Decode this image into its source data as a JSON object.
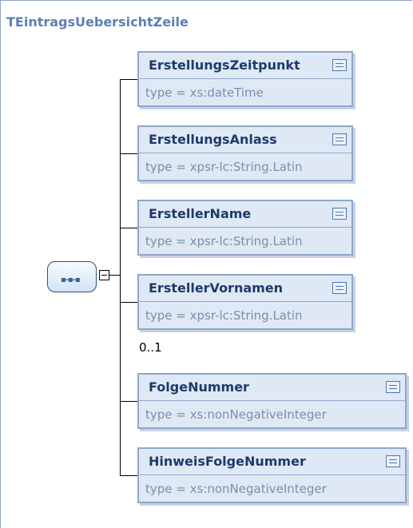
{
  "diagram": {
    "title": "TEintragsUebersichtZeile",
    "compositor": "sequence",
    "elements": [
      {
        "name": "ErstellungsZeitpunkt",
        "type": "type = xs:dateTime",
        "occurrence": ""
      },
      {
        "name": "ErstellungsAnlass",
        "type": "type = xpsr-lc:String.Latin",
        "occurrence": ""
      },
      {
        "name": "ErstellerName",
        "type": "type = xpsr-lc:String.Latin",
        "occurrence": ""
      },
      {
        "name": "ErstellerVornamen",
        "type": "type = xpsr-lc:String.Latin",
        "occurrence": "0..1"
      },
      {
        "name": "FolgeNummer",
        "type": "type = xs:nonNegativeInteger",
        "occurrence": ""
      },
      {
        "name": "HinweisFolgeNummer",
        "type": "type = xs:nonNegativeInteger",
        "occurrence": ""
      }
    ]
  }
}
